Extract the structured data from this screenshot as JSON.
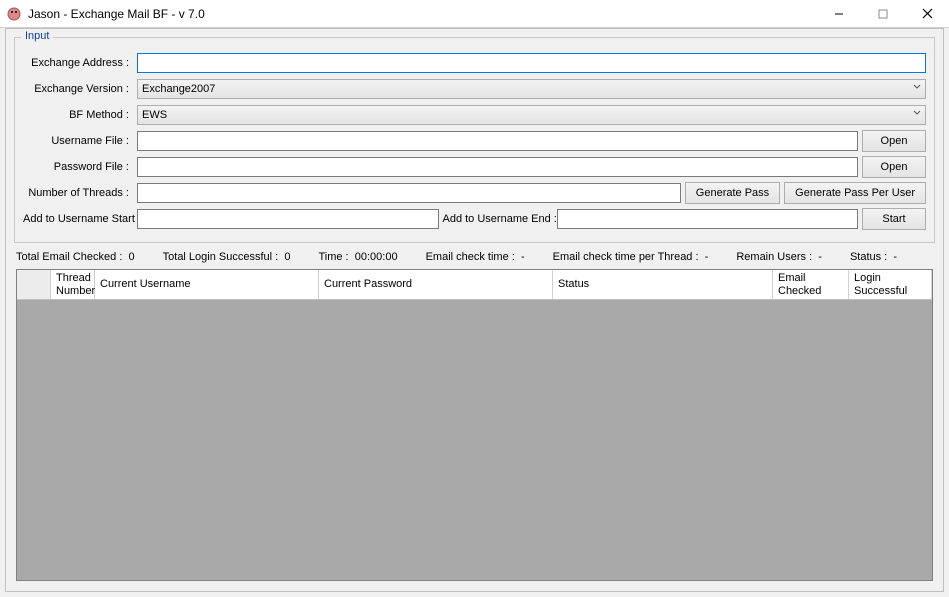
{
  "window": {
    "title": "Jason - Exchange Mail BF - v 7.0"
  },
  "groupbox": {
    "title": "Input"
  },
  "labels": {
    "exchange_address": "Exchange Address :",
    "exchange_version": "Exchange Version :",
    "bf_method": "BF Method :",
    "username_file": "Username File :",
    "password_file": "Password File :",
    "num_threads": "Number of Threads :",
    "add_user_start": "Add to Username Start :",
    "add_user_end": "Add to Username End :"
  },
  "values": {
    "exchange_address": "",
    "exchange_version": "Exchange2007",
    "bf_method": "EWS",
    "username_file": "",
    "password_file": "",
    "num_threads": "",
    "add_user_start": "",
    "add_user_end": ""
  },
  "buttons": {
    "open": "Open",
    "generate_pass": "Generate Pass",
    "generate_pass_per_user": "Generate Pass Per User",
    "start": "Start"
  },
  "status": {
    "total_email_checked_label": "Total Email Checked :",
    "total_email_checked_value": "0",
    "total_login_label": "Total Login Successful :",
    "total_login_value": "0",
    "time_label": "Time :",
    "time_value": "00:00:00",
    "email_check_time_label": "Email check time :",
    "email_check_time_value": "-",
    "email_check_time_thread_label": "Email check time per Thread :",
    "email_check_time_thread_value": "-",
    "remain_users_label": "Remain Users :",
    "remain_users_value": "-",
    "status_label": "Status :",
    "status_value": "-"
  },
  "columns": {
    "thread_number": "Thread Number",
    "current_username": "Current Username",
    "current_password": "Current Password",
    "status": "Status",
    "email_checked": "Email Checked",
    "login_successful": "Login Successful"
  }
}
